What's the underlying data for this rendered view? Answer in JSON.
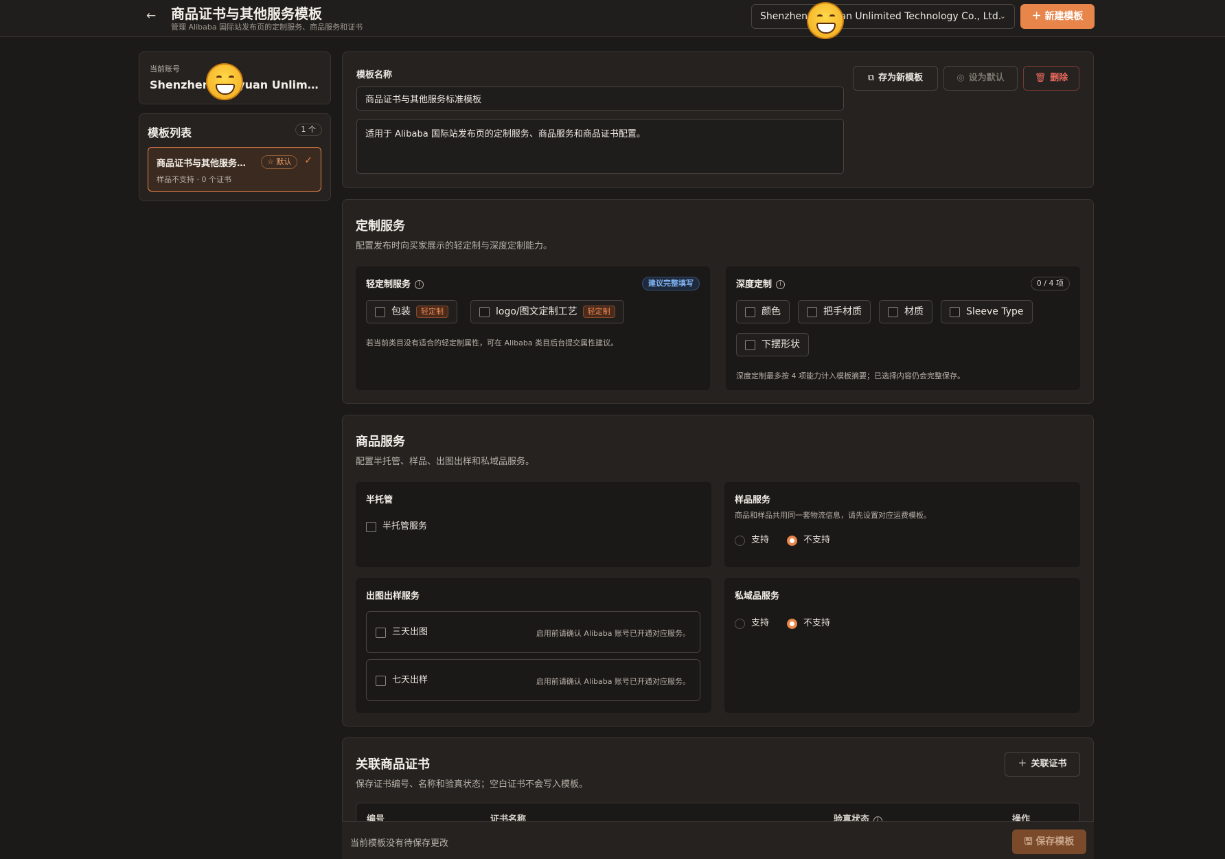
{
  "header": {
    "title": "商品证书与其他服务模板",
    "subtitle": "管理 Alibaba 国际站发布页的定制服务、商品服务和证书",
    "account_selector": "Shenzhen Kuoyuan Unlimited Technology Co., Ltd.",
    "new_template_label": "新建模板"
  },
  "account_card": {
    "label": "当前账号",
    "name": "Shenzhen Kuoyuan Unlimited Technology Co., Ltd."
  },
  "template_list": {
    "title": "模板列表",
    "count": "1 个",
    "items": [
      {
        "name": "商品证书与其他服务标准模板",
        "badge": "默认",
        "meta": "样品不支持 · 0 个证书"
      }
    ]
  },
  "template_form": {
    "name_label": "模板名称",
    "name_value": "商品证书与其他服务标准模板",
    "description_value": "适用于 Alibaba 国际站发布页的定制服务、商品服务和商品证书配置。",
    "save_as_new_label": "存为新模板",
    "set_default_label": "设为默认",
    "delete_label": "删除"
  },
  "custom_service": {
    "title": "定制服务",
    "desc": "配置发布时向买家展示的轻定制与深度定制能力。",
    "light": {
      "title": "轻定制服务",
      "hint": "建议完整填写",
      "options": [
        {
          "label": "包装",
          "tag": "轻定制"
        },
        {
          "label": "logo/图文定制工艺",
          "tag": "轻定制"
        }
      ],
      "note": "若当前类目没有适合的轻定制属性，可在 Alibaba 类目后台提交属性建议。"
    },
    "deep": {
      "title": "深度定制",
      "count": "0 / 4 项",
      "options": [
        "颜色",
        "把手材质",
        "材质",
        "Sleeve Type",
        "下摆形状"
      ],
      "note": "深度定制最多按 4 项能力计入模板摘要；已选择内容仍会完整保存。"
    }
  },
  "product_service": {
    "title": "商品服务",
    "desc": "配置半托管、样品、出图出样和私域品服务。",
    "semi_managed": {
      "title": "半托管",
      "option": "半托管服务"
    },
    "sample": {
      "title": "样品服务",
      "desc": "商品和样品共用同一套物流信息，请先设置对应运费模板。",
      "support": "支持",
      "not_support": "不支持",
      "selected": "不支持"
    },
    "render_sample": {
      "title": "出图出样服务",
      "items": [
        {
          "label": "三天出图",
          "note": "启用前请确认 Alibaba 账号已开通对应服务。"
        },
        {
          "label": "七天出样",
          "note": "启用前请确认 Alibaba 账号已开通对应服务。"
        }
      ]
    },
    "private": {
      "title": "私域品服务",
      "support": "支持",
      "not_support": "不支持",
      "selected": "不支持"
    }
  },
  "certificates": {
    "title": "关联商品证书",
    "desc": "保存证书编号、名称和验真状态；空白证书不会写入模板。",
    "link_label": "关联证书",
    "columns": [
      "编号",
      "证书名称",
      "验真状态",
      "操作"
    ]
  },
  "footer": {
    "status": "当前模板没有待保存更改",
    "save_label": "保存模板"
  },
  "colors": {
    "accent": "#e8854a",
    "background": "#1c1a18",
    "panel": "#252220",
    "danger": "#ee6b5e"
  }
}
